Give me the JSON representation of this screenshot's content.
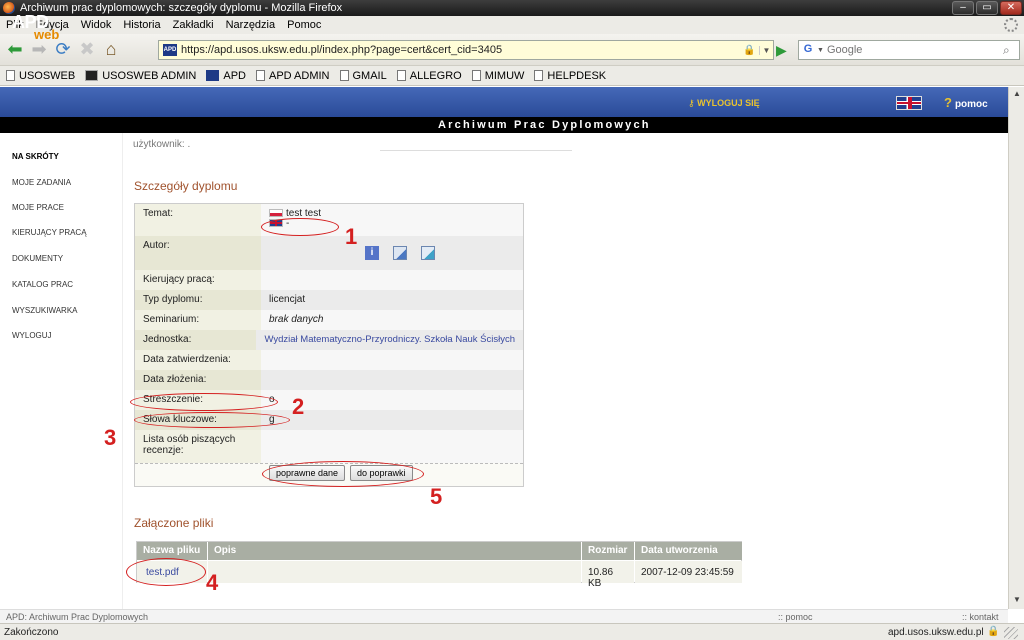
{
  "window": {
    "title": "Archiwum prac dyplomowych: szczegóły dyplomu - Mozilla Firefox"
  },
  "menu": [
    "Plik",
    "Edycja",
    "Widok",
    "Historia",
    "Zakładki",
    "Narzędzia",
    "Pomoc"
  ],
  "nav": {
    "url": "https://apd.usos.uksw.edu.pl/index.php?page=cert&cert_cid=3405",
    "search_placeholder": "Google"
  },
  "bookmarks": [
    "USOSWEB",
    "USOSWEB ADMIN",
    "APD",
    "APD ADMIN",
    "GMAIL",
    "ALLEGRO",
    "MIMUW",
    "HELPDESK"
  ],
  "apd": {
    "logo_main": "APD",
    "logo_sub": "web",
    "logout": "WYLOGUJ SIĘ",
    "help": "pomoc",
    "banner": "Archiwum Prac Dyplomowych"
  },
  "sidebar": [
    "NA SKRÓTY",
    "MOJE ZADANIA",
    "MOJE PRACE",
    "KIERUJĄCY PRACĄ",
    "DOKUMENTY",
    "KATALOG PRAC",
    "WYSZUKIWARKA",
    "WYLOGUJ"
  ],
  "user_line": "użytkownik: .",
  "details": {
    "title": "Szczegóły dyplomu",
    "topic_pl": "test test",
    "topic_en": "-",
    "rows": [
      {
        "label": "Temat:",
        "value": ""
      },
      {
        "label": "Autor:",
        "value": ""
      },
      {
        "label": "Kierujący pracą:",
        "value": ""
      },
      {
        "label": "Typ dyplomu:",
        "value": "licencjat"
      },
      {
        "label": "Seminarium:",
        "value": "brak danych"
      },
      {
        "label": "Jednostka:",
        "value": "Wydział Matematyczno-Przyrodniczy. Szkoła Nauk Ścisłych"
      },
      {
        "label": "Data zatwierdzenia:",
        "value": ""
      },
      {
        "label": "Data złożenia:",
        "value": ""
      },
      {
        "label": "Streszczenie:",
        "value": "o"
      },
      {
        "label": "Słowa kluczowe:",
        "value": "g"
      },
      {
        "label": "Lista osób piszących recenzje:",
        "value": ""
      }
    ],
    "btn_ok": "poprawne dane",
    "btn_fix": "do poprawki"
  },
  "files": {
    "title": "Załączone pliki",
    "headers": [
      "Nazwa pliku",
      "Opis",
      "Rozmiar",
      "Data utworzenia"
    ],
    "row": {
      "name": "test.pdf",
      "desc": "",
      "size": "10.86 KB",
      "date": "2007-12-09 23:45:59"
    }
  },
  "annotations": [
    "1",
    "2",
    "3",
    "4",
    "5"
  ],
  "footer": {
    "left": "APD: Archiwum Prac Dyplomowych",
    "help": ":: pomoc",
    "contact": ":: kontakt"
  },
  "status": {
    "text": "Zakończono",
    "domain": "apd.usos.uksw.edu.pl"
  },
  "colors": {
    "header_blue": "#2a4a98",
    "section_title": "#a0522d",
    "annotation_red": "#d42020"
  }
}
